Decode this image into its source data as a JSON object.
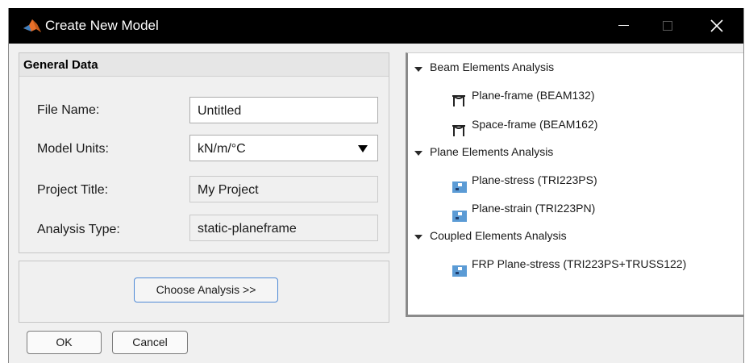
{
  "window": {
    "title": "Create New Model",
    "icon": "matlab-logo-icon",
    "controls": [
      "minimize-icon",
      "maximize-icon",
      "close-icon"
    ]
  },
  "general": {
    "header": "General Data",
    "file_name_label": "File Name:",
    "file_name_value": "Untitled",
    "units_label": "Model Units:",
    "units_value": "kN/m/°C",
    "project_label": "Project Title:",
    "project_value": "My Project",
    "analysis_label": "Analysis Type:",
    "analysis_value": "static-planeframe"
  },
  "analysis": {
    "choose_label": "Choose Analysis >>"
  },
  "footer": {
    "ok_label": "OK",
    "cancel_label": "Cancel"
  },
  "tree": {
    "groups": [
      {
        "label": "Beam Elements Analysis",
        "expanded": true,
        "items": [
          {
            "label": "Plane-frame (BEAM132)",
            "icon": "frame-element-icon"
          },
          {
            "label": "Space-frame (BEAM162)",
            "icon": "frame-element-icon"
          }
        ]
      },
      {
        "label": "Plane Elements Analysis",
        "expanded": true,
        "items": [
          {
            "label": "Plane-stress (TRI223PS)",
            "icon": "mesh-element-icon"
          },
          {
            "label": "Plane-strain (TRI223PN)",
            "icon": "mesh-element-icon"
          }
        ]
      },
      {
        "label": "Coupled Elements Analysis",
        "expanded": true,
        "items": [
          {
            "label": "FRP Plane-stress (TRI223PS+TRUSS122)",
            "icon": "mesh-element-icon"
          }
        ]
      }
    ]
  },
  "colors": {
    "titlebar": "#000000",
    "dialog_bg": "#f0f0f0",
    "button_focus_border": "#4f8ad6",
    "mesh_icon_blue": "#5b9bd5"
  }
}
